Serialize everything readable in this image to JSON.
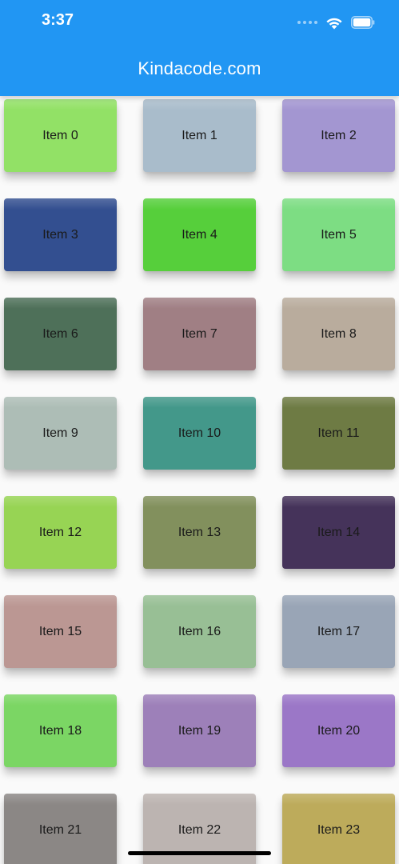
{
  "status_bar": {
    "time": "3:37",
    "wifi_icon": "wifi-icon",
    "battery_icon": "battery-icon"
  },
  "app_bar": {
    "title": "Kindacode.com",
    "background_color": "#2196f3"
  },
  "grid": {
    "columns": 3,
    "items": [
      {
        "label": "Item 0",
        "color": "#92e166"
      },
      {
        "label": "Item 1",
        "color": "#a9bccb"
      },
      {
        "label": "Item 2",
        "color": "#a396d1"
      },
      {
        "label": "Item 3",
        "color": "#334f90"
      },
      {
        "label": "Item 4",
        "color": "#56cf3b"
      },
      {
        "label": "Item 5",
        "color": "#7ddd83"
      },
      {
        "label": "Item 6",
        "color": "#4e7059"
      },
      {
        "label": "Item 7",
        "color": "#a07f84"
      },
      {
        "label": "Item 8",
        "color": "#b9ac9d"
      },
      {
        "label": "Item 9",
        "color": "#adbdb6"
      },
      {
        "label": "Item 10",
        "color": "#43988a"
      },
      {
        "label": "Item 11",
        "color": "#6e7b44"
      },
      {
        "label": "Item 12",
        "color": "#97d454"
      },
      {
        "label": "Item 13",
        "color": "#82905d"
      },
      {
        "label": "Item 14",
        "color": "#45335a"
      },
      {
        "label": "Item 15",
        "color": "#bb9793"
      },
      {
        "label": "Item 16",
        "color": "#98bf95"
      },
      {
        "label": "Item 17",
        "color": "#99a5b6"
      },
      {
        "label": "Item 18",
        "color": "#7bd664"
      },
      {
        "label": "Item 19",
        "color": "#9d80b9"
      },
      {
        "label": "Item 20",
        "color": "#9b77c7"
      },
      {
        "label": "Item 21",
        "color": "#8b8785"
      },
      {
        "label": "Item 22",
        "color": "#bcb4b1"
      },
      {
        "label": "Item 23",
        "color": "#bdab5b"
      }
    ]
  }
}
